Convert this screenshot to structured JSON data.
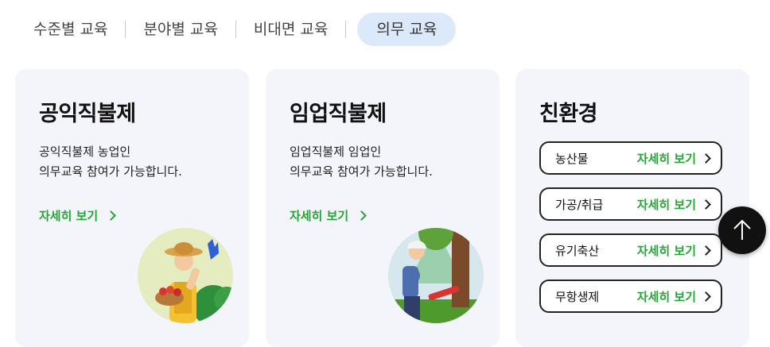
{
  "tabs": [
    {
      "label": "수준별 교육"
    },
    {
      "label": "분야별 교육"
    },
    {
      "label": "비대면 교육"
    },
    {
      "label": "의무 교육",
      "active": true
    }
  ],
  "cards": [
    {
      "title": "공익직불제",
      "desc_line1": "공익직불제 농업인",
      "desc_line2": "의무교육 참여가 가능합니다.",
      "link": "자세히 보기",
      "illustration": "farmer-illustration"
    },
    {
      "title": "임업직불제",
      "desc_line1": "임업직불제 임업인",
      "desc_line2": "의무교육 참여가 가능합니다.",
      "link": "자세히 보기",
      "illustration": "forester-illustration"
    }
  ],
  "eco": {
    "title": "친환경",
    "items": [
      {
        "label": "농산물",
        "link": "자세히 보기"
      },
      {
        "label": "가공/취급",
        "link": "자세히 보기"
      },
      {
        "label": "유기축산",
        "link": "자세히 보기"
      },
      {
        "label": "무항생제",
        "link": "자세히 보기"
      }
    ]
  },
  "colors": {
    "accent_green": "#27a337",
    "active_tab_bg": "#dbe9fb",
    "card_bg": "#f4f5fa"
  },
  "top_button": {
    "icon": "arrow-up-icon"
  }
}
